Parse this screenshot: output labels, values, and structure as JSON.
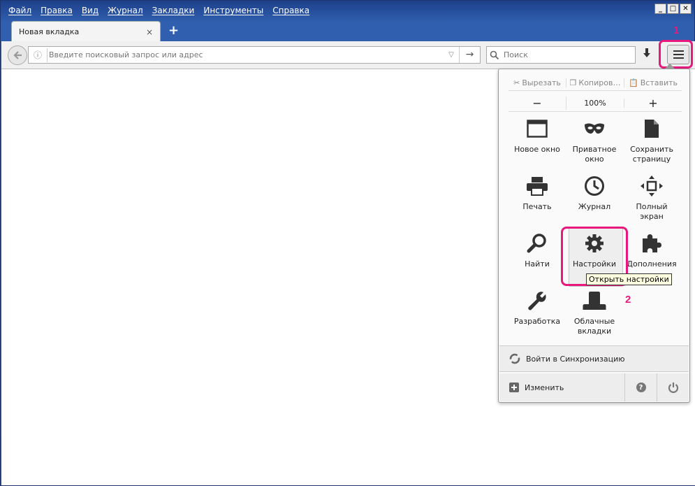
{
  "menubar": [
    "Файл",
    "Правка",
    "Вид",
    "Журнал",
    "Закладки",
    "Инструменты",
    "Справка"
  ],
  "window_controls": {
    "minimize": "_",
    "maximize": "□",
    "close": "✕"
  },
  "tab": {
    "title": "Новая вкладка",
    "close": "×",
    "new_tab": "+"
  },
  "nav": {
    "url_placeholder": "Введите поисковый запрос или адрес",
    "search_placeholder": "Поиск"
  },
  "panel": {
    "edit": {
      "cut": "Вырезать",
      "copy": "Копиров…",
      "paste": "Вставить"
    },
    "zoom": {
      "minus": "−",
      "level": "100%",
      "plus": "+"
    },
    "items": [
      {
        "label": "Новое окно",
        "icon": "new-window-icon"
      },
      {
        "label": "Приватное окно",
        "icon": "private-mask-icon"
      },
      {
        "label": "Сохранить страницу",
        "icon": "save-page-icon"
      },
      {
        "label": "Печать",
        "icon": "printer-icon"
      },
      {
        "label": "Журнал",
        "icon": "history-clock-icon"
      },
      {
        "label": "Полный экран",
        "icon": "fullscreen-icon"
      },
      {
        "label": "Найти",
        "icon": "search-icon"
      },
      {
        "label": "Настройки",
        "icon": "gear-icon"
      },
      {
        "label": "Дополнения",
        "icon": "puzzle-icon"
      },
      {
        "label": "Разработка",
        "icon": "wrench-icon"
      },
      {
        "label": "Облачные вкладки",
        "icon": "cloud-tabs-icon"
      }
    ],
    "sync": "Войти в Синхронизацию",
    "customize": "Изменить",
    "help": "?",
    "tooltip": "Открыть настройки"
  },
  "annotations": {
    "step1": "1",
    "step2": "2",
    "highlight_color": "#e8197d"
  }
}
